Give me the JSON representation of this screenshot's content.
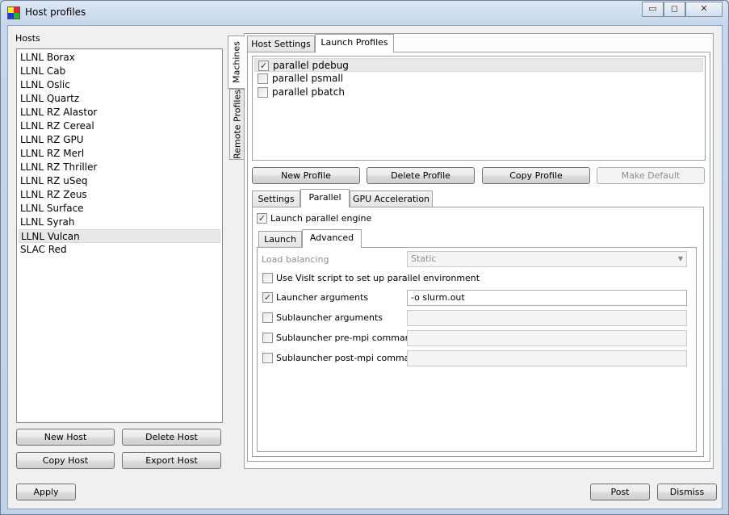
{
  "window": {
    "title": "Host profiles",
    "minimize_glyph": "▭",
    "maximize_glyph": "◻",
    "close_glyph": "✕"
  },
  "hosts": {
    "label": "Hosts",
    "items": [
      "LLNL Borax",
      "LLNL Cab",
      "LLNL Oslic",
      "LLNL Quartz",
      "LLNL RZ Alastor",
      "LLNL RZ Cereal",
      "LLNL RZ GPU",
      "LLNL RZ Merl",
      "LLNL RZ Thriller",
      "LLNL RZ uSeq",
      "LLNL RZ Zeus",
      "LLNL Surface",
      "LLNL Syrah",
      "LLNL Vulcan",
      "SLAC Red"
    ],
    "selected_index": 13,
    "new_host": "New Host",
    "delete_host": "Delete Host",
    "copy_host": "Copy Host",
    "export_host": "Export Host"
  },
  "side_tabs": [
    "Machines",
    "Remote Profiles"
  ],
  "top_tabs": [
    "Host Settings",
    "Launch Profiles"
  ],
  "profiles": [
    {
      "label": "parallel pdebug",
      "checked": true
    },
    {
      "label": "parallel psmall",
      "checked": false
    },
    {
      "label": "parallel pbatch",
      "checked": false
    }
  ],
  "profile_buttons": {
    "new_profile": "New Profile",
    "delete_profile": "Delete Profile",
    "copy_profile": "Copy Profile",
    "make_default": "Make Default"
  },
  "settings_tabs": [
    "Settings",
    "Parallel",
    "GPU Acceleration"
  ],
  "parallel": {
    "launch_engine_label": "Launch parallel engine",
    "launch_engine_checked": true,
    "sub_tabs": [
      "Launch",
      "Advanced"
    ],
    "load_balancing_label": "Load balancing",
    "load_balancing_value": "Static",
    "use_visit_script_label": "Use VisIt script to set up parallel environment",
    "launcher_args_label": "Launcher arguments",
    "launcher_args_value": "-o slurm.out",
    "sublauncher_args_label": "Sublauncher arguments",
    "sublauncher_pre_label": "Sublauncher pre-mpi command",
    "sublauncher_post_label": "Sublauncher post-mpi command",
    "check_glyph": "✓",
    "dropdown_glyph": "▼"
  },
  "footer": {
    "apply": "Apply",
    "post": "Post",
    "dismiss": "Dismiss"
  }
}
